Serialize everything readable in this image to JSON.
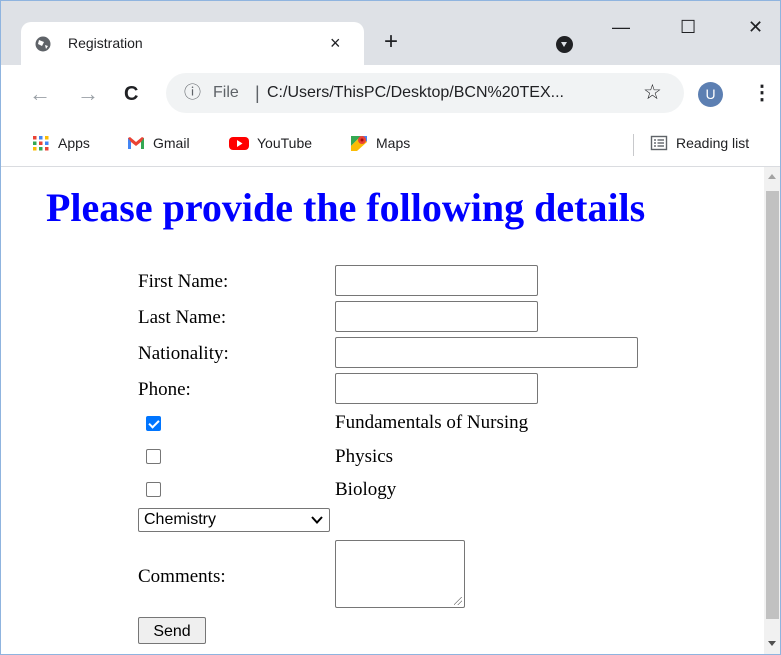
{
  "browser": {
    "tab_title": "Registration",
    "tab_close": "×",
    "new_tab": "+",
    "window_minimize": "—",
    "window_maximize": "☐",
    "window_close": "✕",
    "nav_back": "←",
    "nav_forward": "→",
    "nav_reload": "C",
    "address_info_icon": "ⓘ",
    "address_scheme": "File",
    "address_separator": "|",
    "address_url": "C:/Users/ThisPC/Desktop/BCN%20TEX...",
    "bookmark_star": "☆",
    "profile_initial": "U",
    "menu": "⋮",
    "bookmarks": [
      {
        "label": "Apps",
        "icon": "apps-grid-icon"
      },
      {
        "label": "Gmail",
        "icon": "gmail-icon"
      },
      {
        "label": "YouTube",
        "icon": "youtube-icon"
      },
      {
        "label": "Maps",
        "icon": "maps-icon"
      }
    ],
    "reading_list": "Reading list"
  },
  "page": {
    "heading": "Please provide the following details",
    "first_name_label": "First Name:",
    "first_name_value": "",
    "last_name_label": "Last Name:",
    "last_name_value": "",
    "nationality_label": "Nationality:",
    "nationality_value": "",
    "phone_label": "Phone:",
    "phone_value": "",
    "courses": [
      {
        "label": "Fundamentals of Nursing",
        "checked": true
      },
      {
        "label": "Physics",
        "checked": false
      },
      {
        "label": "Biology",
        "checked": false
      }
    ],
    "subject_select_value": "Chemistry",
    "comments_label": "Comments:",
    "comments_value": "",
    "send_label": "Send"
  },
  "colors": {
    "heading": "#0000ff",
    "checkbox_checked": "#0075ff",
    "titlebar": "#dee1e6",
    "avatar": "#5c7fb2"
  }
}
